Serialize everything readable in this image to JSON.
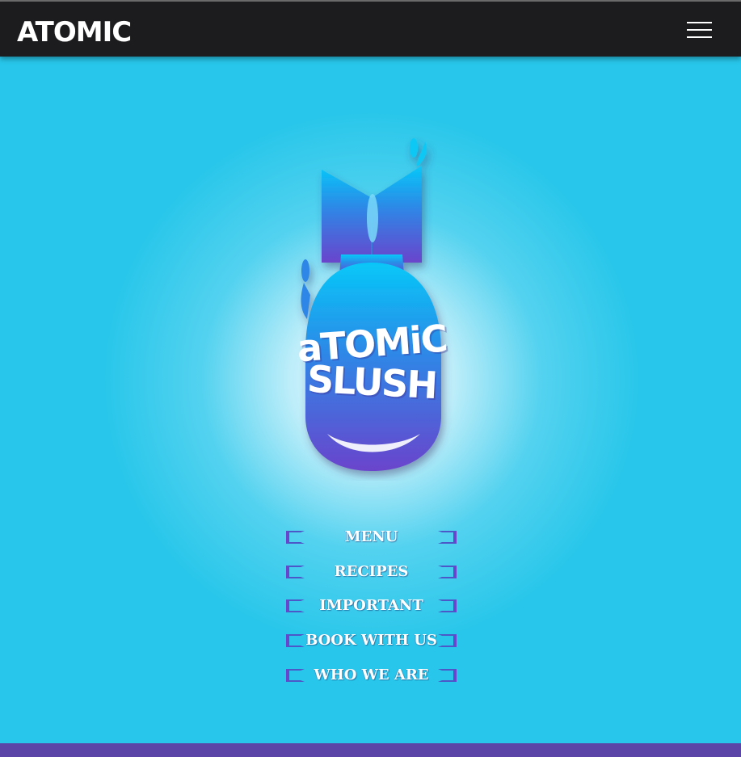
{
  "header": {
    "brand": "ATOMIC",
    "menu_icon": "hamburger-menu-icon"
  },
  "hero": {
    "logo_line1": "aTOMiC",
    "logo_line2": "SLUSH",
    "logo_icon": "bomb-logo-icon"
  },
  "nav": {
    "items": [
      {
        "label": "MENU"
      },
      {
        "label": "RECIPES"
      },
      {
        "label": "IMPORTANT"
      },
      {
        "label": "BOOK WITH US"
      },
      {
        "label": "WHO WE ARE"
      }
    ]
  },
  "colors": {
    "background": "#27c6ea",
    "navbar": "#1c1c1e",
    "accent_purple": "#5b46a8",
    "logo_top": "#10c8f4",
    "logo_bottom": "#6a44cc"
  }
}
